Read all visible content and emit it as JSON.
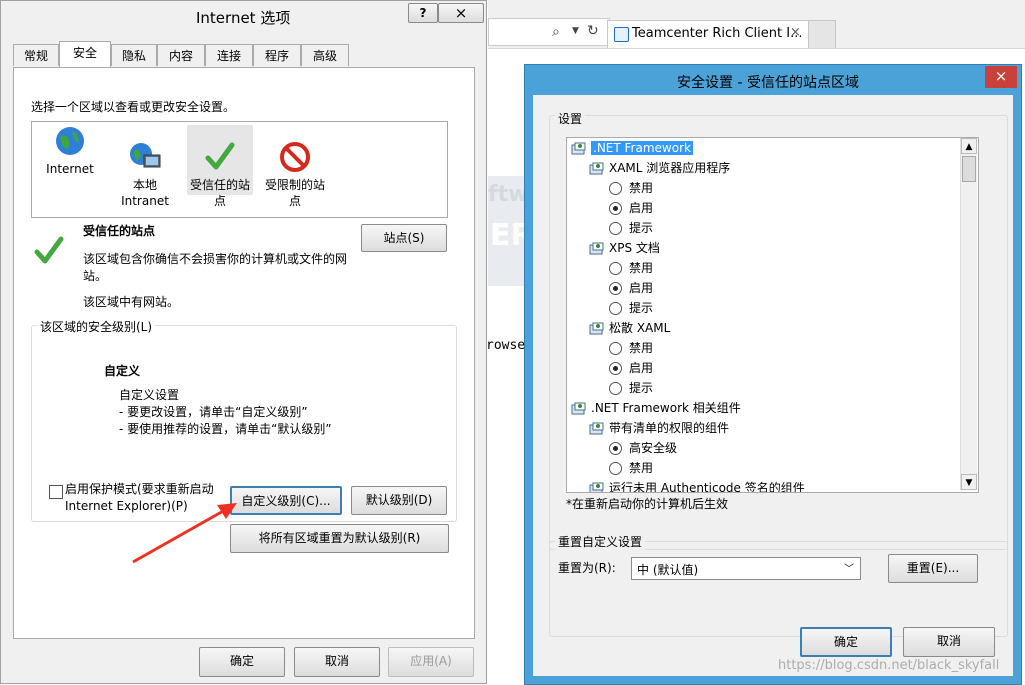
{
  "browser": {
    "tab_title": "Teamcenter Rich Client I...",
    "tab_close": "×",
    "page_fragments": [
      "ftw",
      "ER",
      "rowse"
    ],
    "watermark": "https://blog.csdn.net/black_skyfall"
  },
  "internet_options": {
    "title": "Internet 选项",
    "help_btn": "?",
    "close_btn": "×",
    "tabs": [
      "常规",
      "安全",
      "隐私",
      "内容",
      "连接",
      "程序",
      "高级"
    ],
    "active_tab": "安全",
    "zone_prompt": "选择一个区域以查看或更改安全设置。",
    "zones": [
      {
        "name": "Internet",
        "icon": "globe-icon"
      },
      {
        "name": "本地\nIntranet",
        "icon": "intranet-icon"
      },
      {
        "name": "受信任的站\n点",
        "icon": "checkmark-icon"
      },
      {
        "name": "受限制的站\n点",
        "icon": "no-entry-icon"
      }
    ],
    "zone_title": "受信任的站点",
    "zone_desc": "该区域包含你确信不会损害你的计算机或文件的网站。",
    "zone_note": "该区域中有网站。",
    "sites_btn": "站点(S)",
    "level_group_label": "该区域的安全级别(L)",
    "level_name": "自定义",
    "level_desc_lines": [
      "自定义设置",
      "- 要更改设置，请单击“自定义级别”",
      "- 要使用推荐的设置，请单击“默认级别”"
    ],
    "protected_mode": "启用保护模式(要求重新启动 Internet Explorer)(P)",
    "protected_mode_checked": false,
    "custom_level_btn": "自定义级别(C)...",
    "default_level_btn": "默认级别(D)",
    "reset_all_btn": "将所有区域重置为默认级别(R)",
    "ok_btn": "确定",
    "cancel_btn": "取消",
    "apply_btn": "应用(A)"
  },
  "security_settings": {
    "title": "安全设置 - 受信任的站点区域",
    "close_btn": "×",
    "settings_label": "设置",
    "tree": [
      {
        "type": "category",
        "label": ".NET Framework",
        "level": 0,
        "selected": true
      },
      {
        "type": "category",
        "label": "XAML 浏览器应用程序",
        "level": 1
      },
      {
        "type": "option",
        "label": "禁用",
        "level": 2,
        "checked": false
      },
      {
        "type": "option",
        "label": "启用",
        "level": 2,
        "checked": true
      },
      {
        "type": "option",
        "label": "提示",
        "level": 2,
        "checked": false
      },
      {
        "type": "category",
        "label": "XPS 文档",
        "level": 1
      },
      {
        "type": "option",
        "label": "禁用",
        "level": 2,
        "checked": false
      },
      {
        "type": "option",
        "label": "启用",
        "level": 2,
        "checked": true
      },
      {
        "type": "option",
        "label": "提示",
        "level": 2,
        "checked": false
      },
      {
        "type": "category",
        "label": "松散 XAML",
        "level": 1
      },
      {
        "type": "option",
        "label": "禁用",
        "level": 2,
        "checked": false
      },
      {
        "type": "option",
        "label": "启用",
        "level": 2,
        "checked": true
      },
      {
        "type": "option",
        "label": "提示",
        "level": 2,
        "checked": false
      },
      {
        "type": "category",
        "label": ".NET Framework 相关组件",
        "level": 0
      },
      {
        "type": "category",
        "label": "带有清单的权限的组件",
        "level": 1
      },
      {
        "type": "option",
        "label": "高安全级",
        "level": 2,
        "checked": true
      },
      {
        "type": "option",
        "label": "禁用",
        "level": 2,
        "checked": false
      },
      {
        "type": "category",
        "label": "运行未用 Authenticode 签名的组件",
        "level": 1
      }
    ],
    "restart_note": "*在重新启动你的计算机后生效",
    "reset_group_label": "重置自定义设置",
    "reset_to_label": "重置为(R):",
    "reset_to_value": "中 (默认值)",
    "reset_btn": "重置(E)...",
    "ok_btn": "确定",
    "cancel_btn": "取消"
  },
  "annotation": {
    "color": "#ee3124"
  }
}
